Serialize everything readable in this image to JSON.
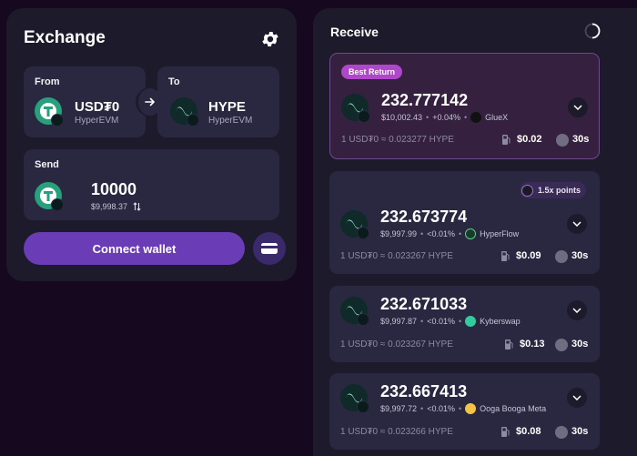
{
  "exchange": {
    "title": "Exchange",
    "from_label": "From",
    "to_label": "To",
    "send_label": "Send",
    "from_token": {
      "symbol": "USD₮0",
      "chain": "HyperEVM"
    },
    "to_token": {
      "symbol": "HYPE",
      "chain": "HyperEVM"
    },
    "send_amount": "10000",
    "send_usd": "$9,998.37",
    "connect_label": "Connect wallet"
  },
  "receive": {
    "title": "Receive",
    "quotes": [
      {
        "pill": "Best Return",
        "amount": "232.777142",
        "usd": "$10,002.43",
        "pct": "+0.04%",
        "provider": "GlueX",
        "rate": "1 USD₮0 ≈ 0.023277 HYPE",
        "gas": "$0.02",
        "time": "30s"
      },
      {
        "pill": "1.5x points",
        "amount": "232.673774",
        "usd": "$9,997.99",
        "pct": "<0.01%",
        "provider": "HyperFlow",
        "rate": "1 USD₮0 ≈ 0.023267 HYPE",
        "gas": "$0.09",
        "time": "30s"
      },
      {
        "amount": "232.671033",
        "usd": "$9,997.87",
        "pct": "<0.01%",
        "provider": "Kyberswap",
        "rate": "1 USD₮0 ≈ 0.023267 HYPE",
        "gas": "$0.13",
        "time": "30s"
      },
      {
        "amount": "232.667413",
        "usd": "$9,997.72",
        "pct": "<0.01%",
        "provider": "Ooga Booga Meta",
        "rate": "1 USD₮0 ≈ 0.023266 HYPE",
        "gas": "$0.08",
        "time": "30s"
      }
    ]
  },
  "colors": {
    "accent": "#6a3cb5",
    "best_pill": "#b046c9",
    "usdt": "#26a17b",
    "hype": "#98f4d8"
  },
  "icons": [
    "gear-icon",
    "arrow-right-icon",
    "swap-icon",
    "wallet-icon",
    "spinner-icon",
    "gas-icon",
    "clock-icon",
    "chevron-down-icon"
  ]
}
